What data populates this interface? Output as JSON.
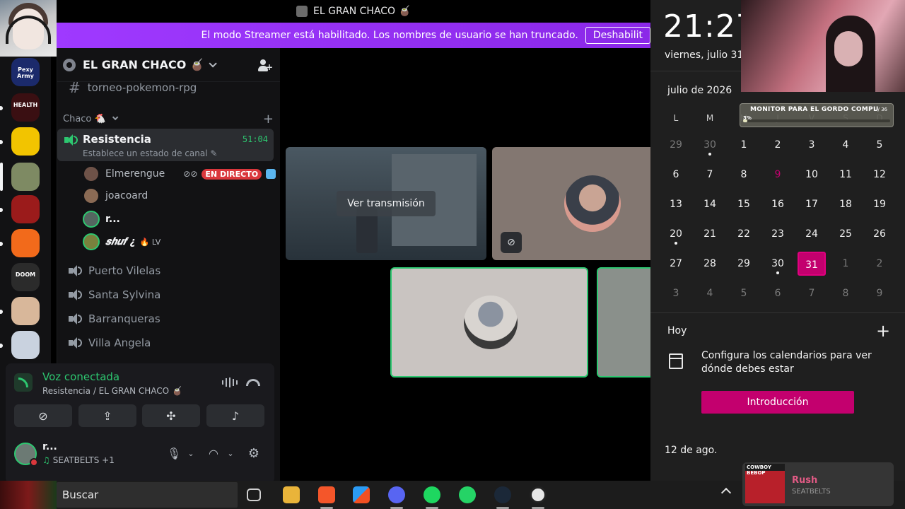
{
  "window": {
    "title": "EL GRAN CHACO 🧉"
  },
  "banner": {
    "text": "El modo Streamer está habilitado. Los nombres de usuario se han truncado.",
    "button": "Deshabilit"
  },
  "rail": {
    "servers": [
      {
        "name": "Pexy Army",
        "label": "Pexy Army",
        "color": "#1b2a6b"
      },
      {
        "name": "HEALTH",
        "label": "HEALTH",
        "color": "#3a0f12"
      },
      {
        "name": "server-3",
        "label": "",
        "color": "#f2c400"
      },
      {
        "name": "server-4",
        "label": "",
        "color": "#7e8a63"
      },
      {
        "name": "server-5",
        "label": "",
        "color": "#9b1b1b"
      },
      {
        "name": "server-6",
        "label": "",
        "color": "#f26a1b"
      },
      {
        "name": "DOOM",
        "label": "DOOM",
        "color": "#2b2b2b"
      },
      {
        "name": "server-8",
        "label": "",
        "color": "#d8b79a"
      },
      {
        "name": "server-9",
        "label": "",
        "color": "#c9d2df"
      }
    ]
  },
  "sidebar": {
    "server_name": "EL GRAN CHACO 🧉",
    "top_channel": "torneo-pokemon-rpg",
    "category": "Chaco 🐔",
    "active_channel": {
      "name": "Resistencia",
      "status": "Establece un estado de canal ✎",
      "elapsed": "51:04"
    },
    "voice_users": [
      {
        "name": "Elmerengue",
        "live": "EN DIRECTO"
      },
      {
        "name": "joacoard"
      },
      {
        "name": "r..."
      },
      {
        "name": "𝒔𝒉𝒖𝒇 ¿",
        "tag": "🔥 LV"
      }
    ],
    "voice_channels": [
      "Puerto Vilelas",
      "Santa Sylvina",
      "Barranqueras",
      "Villa Angela"
    ]
  },
  "voice_panel": {
    "title": "Voz conectada",
    "subtitle": "Resistencia / EL GRAN CHACO 🧉"
  },
  "user": {
    "name": "r...",
    "activity": "SEATBELTS +1"
  },
  "stage": {
    "watch_button": "Ver transmisión"
  },
  "calendar": {
    "time": "21:27",
    "date": "viernes, julio 31",
    "month": "julio de 2026",
    "weekdays": [
      "L",
      "M",
      "M",
      "J",
      "V",
      "S",
      "D"
    ],
    "weeks": [
      [
        "29",
        "30",
        "1",
        "2",
        "3",
        "4",
        "5"
      ],
      [
        "6",
        "7",
        "8",
        "9",
        "10",
        "11",
        "12"
      ],
      [
        "13",
        "14",
        "15",
        "16",
        "17",
        "18",
        "19"
      ],
      [
        "20",
        "21",
        "22",
        "23",
        "24",
        "25",
        "26"
      ],
      [
        "27",
        "28",
        "29",
        "30",
        "31",
        "1",
        "2"
      ],
      [
        "3",
        "4",
        "5",
        "6",
        "7",
        "8",
        "9"
      ]
    ],
    "today": "Hoy",
    "empty_message": "Configura los calendarios para ver dónde debes estar",
    "intro_button": "Introducción",
    "next_date": "12 de ago.",
    "accent": "#c3006e"
  },
  "overlay": {
    "monitor_title": "MONITOR PARA EL GORDO COMPU",
    "monitor_count": "1 / 36",
    "monitor_percent": "3%",
    "monitor_progress": 0.03
  },
  "taskbar": {
    "search": "Buscar"
  },
  "media": {
    "title": "Rush",
    "artist": "SEATBELTS",
    "album_text": "COWBOY BEBOP"
  }
}
